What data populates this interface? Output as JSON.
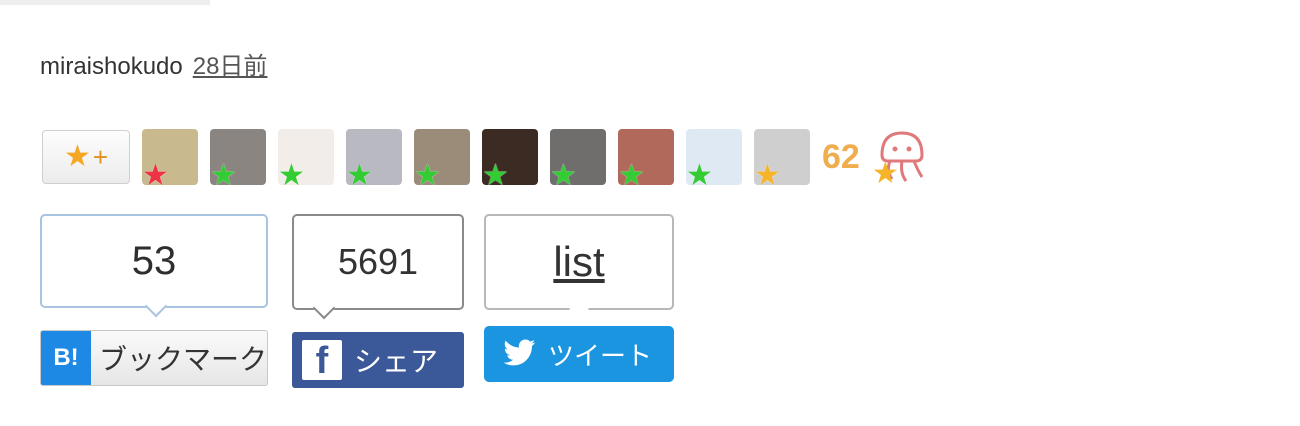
{
  "entry": {
    "username": "miraishokudo",
    "date_label": "28日前"
  },
  "stars": {
    "add_star_plus": "+",
    "avatars": [
      {
        "name": "avatar-1",
        "star": "red",
        "bg": "#c9b98e"
      },
      {
        "name": "avatar-2",
        "star": "green",
        "bg": "#8a8580"
      },
      {
        "name": "avatar-3",
        "star": "green",
        "bg": "#f2ede8"
      },
      {
        "name": "avatar-4",
        "star": "green",
        "bg": "#b9b9c2"
      },
      {
        "name": "avatar-5",
        "star": "green",
        "bg": "#9a8c79"
      },
      {
        "name": "avatar-6",
        "star": "green",
        "bg": "#3b2b22"
      },
      {
        "name": "avatar-7",
        "star": "green",
        "bg": "#6f6e6c"
      },
      {
        "name": "avatar-8",
        "star": "green",
        "bg": "#b0695a"
      },
      {
        "name": "avatar-9",
        "star": "green",
        "bg": "#dfe9f3"
      },
      {
        "name": "avatar-10",
        "star": "yellow",
        "bg": "#cfcfcf"
      }
    ],
    "count": "62"
  },
  "share": {
    "hatena": {
      "count": "53",
      "logo": "B!",
      "label": "ブックマーク"
    },
    "facebook": {
      "count": "5691",
      "logo": "f",
      "label": "シェア"
    },
    "twitter": {
      "count_label": "list",
      "label": "ツイート"
    }
  },
  "colors": {
    "star_yellow": "#f5a623",
    "star_green": "#33cc33",
    "star_red": "#ee3344",
    "hatena_blue": "#1e88e5",
    "facebook_blue": "#3b5998",
    "twitter_blue": "#1b95e0"
  },
  "icons": [
    "star-icon",
    "jellyfish-icon",
    "twitter-bird-icon"
  ]
}
